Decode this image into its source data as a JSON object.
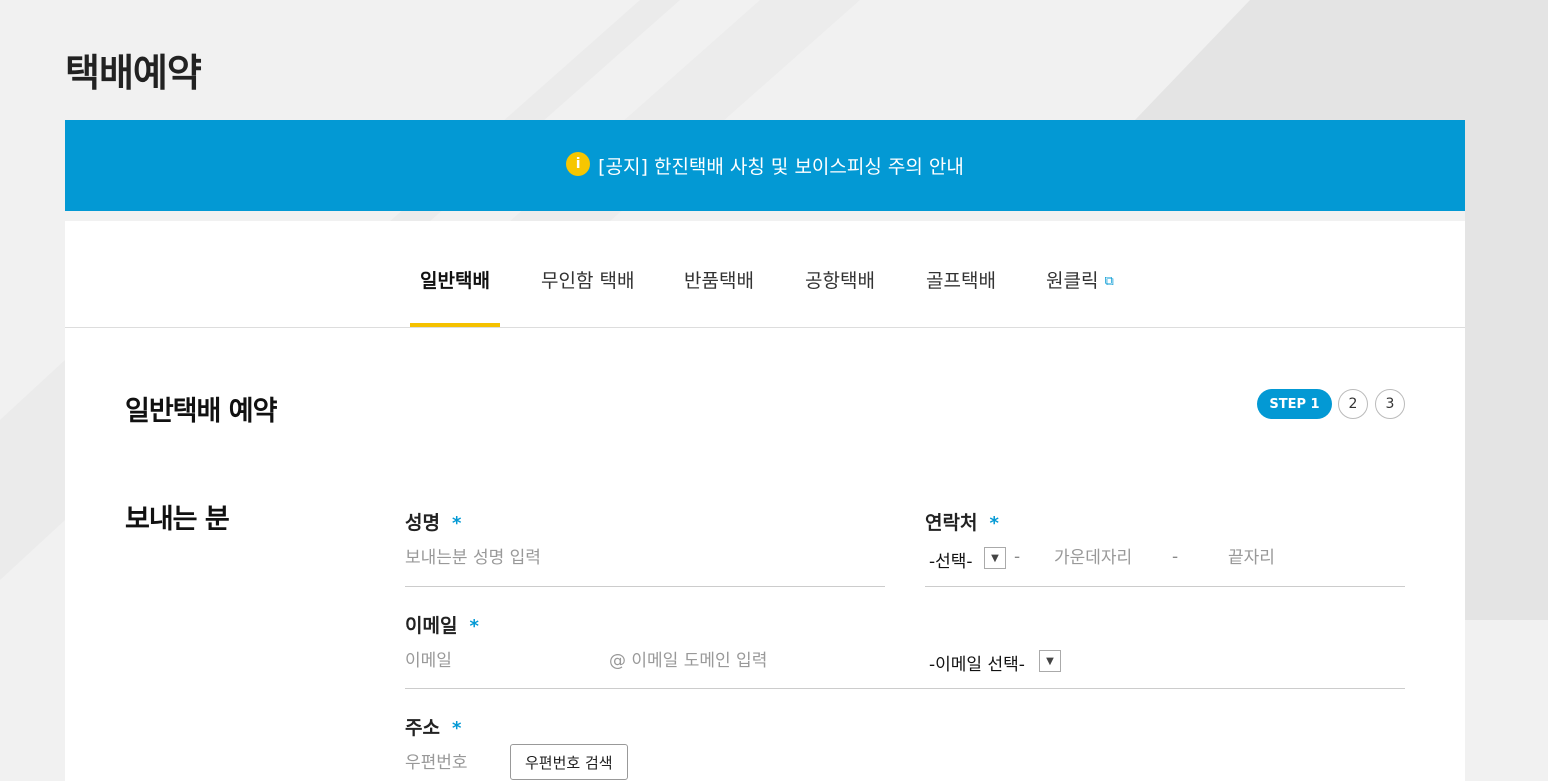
{
  "page": {
    "title": "택배예약"
  },
  "notice": {
    "icon": "info-icon",
    "icon_glyph": "i",
    "text": "[공지] 한진택배 사칭 및 보이스피싱 주의 안내"
  },
  "tabs": [
    {
      "label": "일반택배",
      "active": true
    },
    {
      "label": "무인함 택배"
    },
    {
      "label": "반품택배"
    },
    {
      "label": "공항택배"
    },
    {
      "label": "골프택배"
    },
    {
      "label": "원클릭",
      "icon": "external-link-icon",
      "icon_glyph": "⧉"
    }
  ],
  "form": {
    "title": "일반택배 예약",
    "steps": {
      "step1": "STEP 1",
      "step2": "2",
      "step3": "3",
      "current": 1
    }
  },
  "sender": {
    "section_title": "보내는 분",
    "required_mark": "*",
    "name": {
      "label": "성명",
      "placeholder": "보내는분 성명 입력"
    },
    "contact": {
      "label": "연락처",
      "prefix_select": "-선택-",
      "dash": "-",
      "middle_placeholder": "가운데자리",
      "last_placeholder": "끝자리"
    },
    "email": {
      "label": "이메일",
      "id_placeholder": "이메일",
      "domain_placeholder": "@ 이메일 도메인 입력",
      "domain_select": "-이메일 선택-"
    },
    "address": {
      "label": "주소",
      "zip_placeholder": "우편번호",
      "search_button": "우편번호 검색"
    }
  },
  "colors": {
    "accent": "#0399d4",
    "tab_indicator": "#f5c100",
    "notice_icon": "#f7c600"
  }
}
